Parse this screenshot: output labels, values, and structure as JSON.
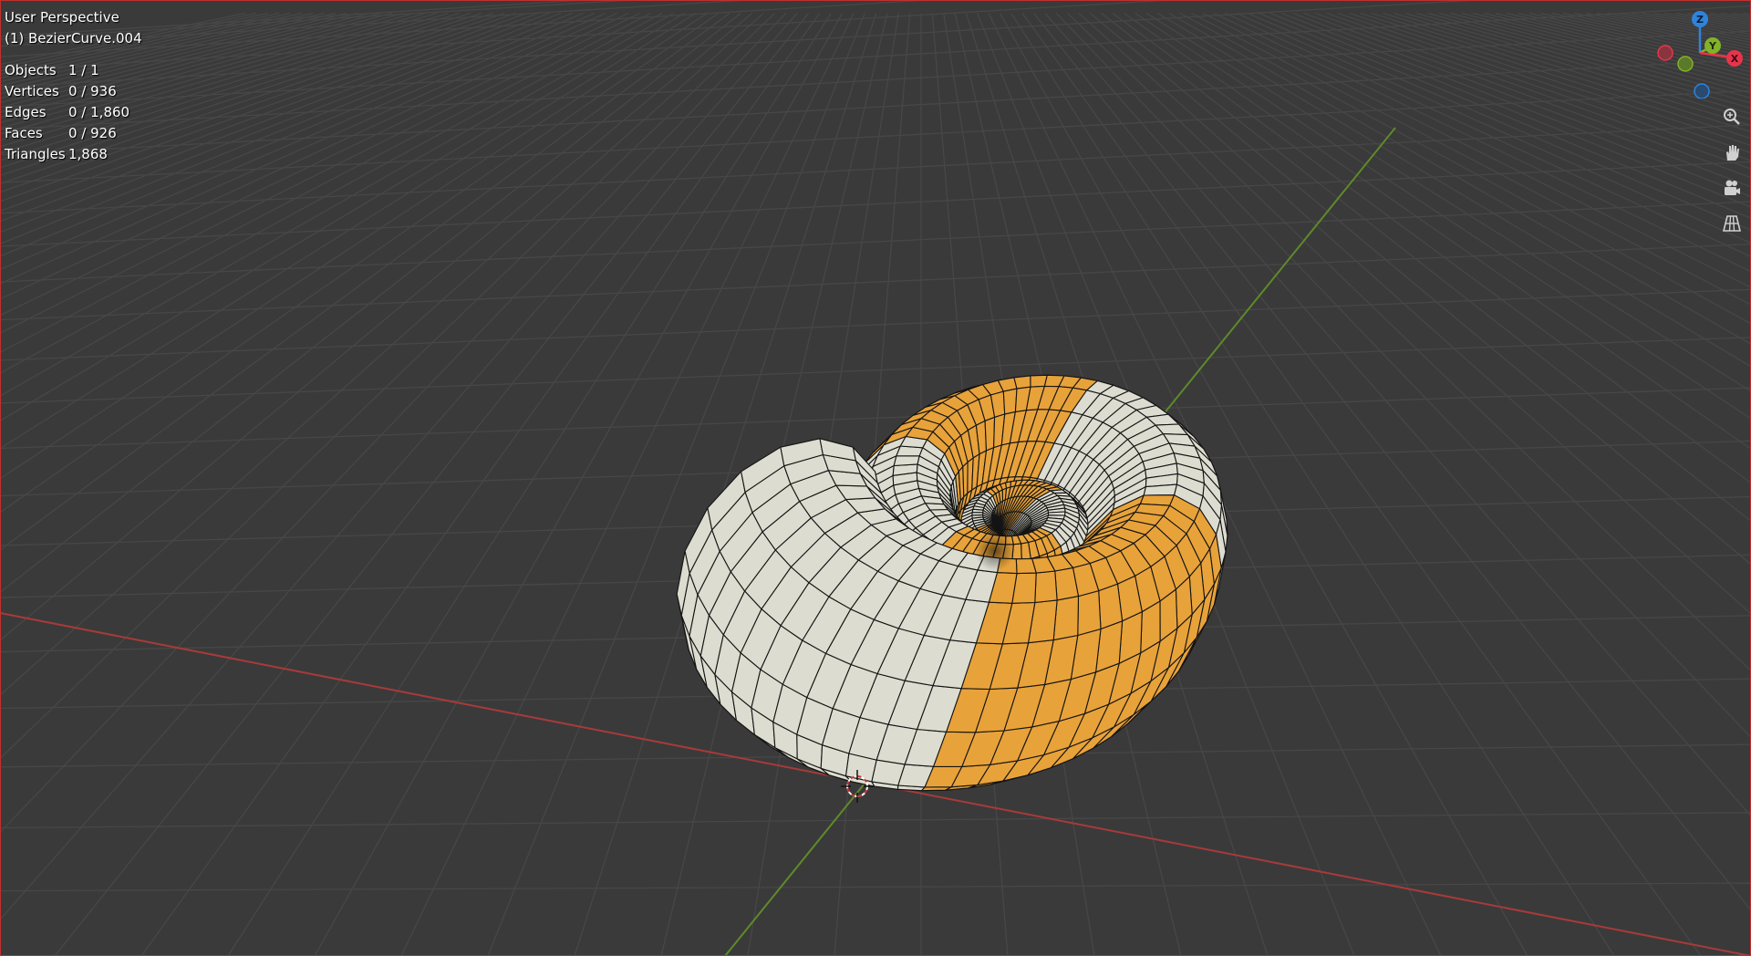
{
  "viewport": {
    "view_label": "User Perspective",
    "object_label": "(1) BezierCurve.004"
  },
  "stats": [
    {
      "label": "Objects",
      "value": "1 / 1"
    },
    {
      "label": "Vertices",
      "value": "0 / 936"
    },
    {
      "label": "Edges",
      "value": "0 / 1,860"
    },
    {
      "label": "Faces",
      "value": "0 / 926"
    },
    {
      "label": "Triangles",
      "value": "1,868"
    }
  ],
  "gizmo": {
    "axes": [
      "Z",
      "Y",
      "X"
    ],
    "colors": {
      "x": "#e8344a",
      "y": "#82b12a",
      "z": "#2f83db"
    }
  },
  "navigation": [
    {
      "name": "zoom",
      "icon": "zoom-icon"
    },
    {
      "name": "pan",
      "icon": "hand-pan-icon"
    },
    {
      "name": "camera",
      "icon": "camera-icon"
    },
    {
      "name": "perspective-toggle",
      "icon": "grid-icon"
    }
  ],
  "colors": {
    "background": "#3a3a3a",
    "grid": "#474747",
    "x_axis": "#a83a3a",
    "y_axis": "#5e8a2a",
    "orange": "#e8a23a",
    "cream": "#dcdcd0",
    "wire": "#141414",
    "frame": "#c13030"
  }
}
